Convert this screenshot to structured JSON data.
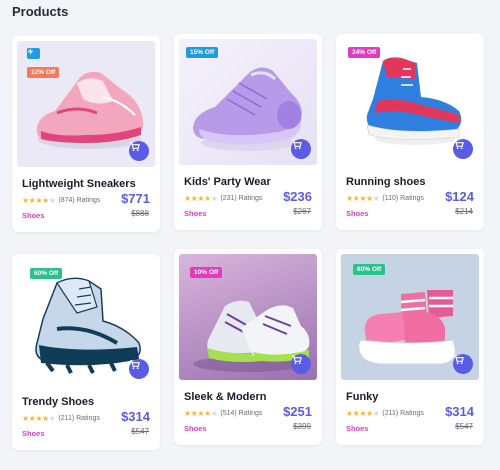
{
  "page": {
    "title": "Products"
  },
  "colors": {
    "accent": "#5b5ce6",
    "category": "#e23bbd",
    "star": "#f6b62e"
  },
  "products": [
    {
      "name": "Lightweight Sneakers",
      "badge": "12% Off",
      "badge_color": "#f47a5b",
      "rating_text": "(874) Ratings",
      "price": "$771",
      "old_price": "$888",
      "category": "Shoes",
      "stars": "★★★★★",
      "rating": 4
    },
    {
      "name": "Kids' Party Wear",
      "badge": "15% Off",
      "badge_color": "#1f9be0",
      "rating_text": "(231) Ratings",
      "price": "$236",
      "old_price": "$267",
      "category": "Shoes",
      "stars": "★★★★★",
      "rating": 4
    },
    {
      "name": "Running shoes",
      "badge": "24% Off",
      "badge_color": "#e23bbd",
      "rating_text": "(110) Ratings",
      "price": "$124",
      "old_price": "$214",
      "category": "Shoes",
      "stars": "★★★★★",
      "rating": 4
    },
    {
      "name": "Trendy Shoes",
      "badge": "60% Off",
      "badge_color": "#28c28a",
      "rating_text": "(211) Ratings",
      "price": "$314",
      "old_price": "$547",
      "category": "Shoes",
      "stars": "★★★★★",
      "rating": 4
    },
    {
      "name": "Sleek & Modern",
      "badge": "10% Off",
      "badge_color": "#e23bbd",
      "rating_text": "(514) Ratings",
      "price": "$251",
      "old_price": "$399",
      "category": "Shoes",
      "stars": "★★★★★",
      "rating": 4
    },
    {
      "name": "Funky",
      "badge": "60% Off",
      "badge_color": "#28c28a",
      "rating_text": "(211) Ratings",
      "price": "$314",
      "old_price": "$547",
      "category": "Shoes",
      "stars": "★★★★★",
      "rating": 4
    }
  ]
}
